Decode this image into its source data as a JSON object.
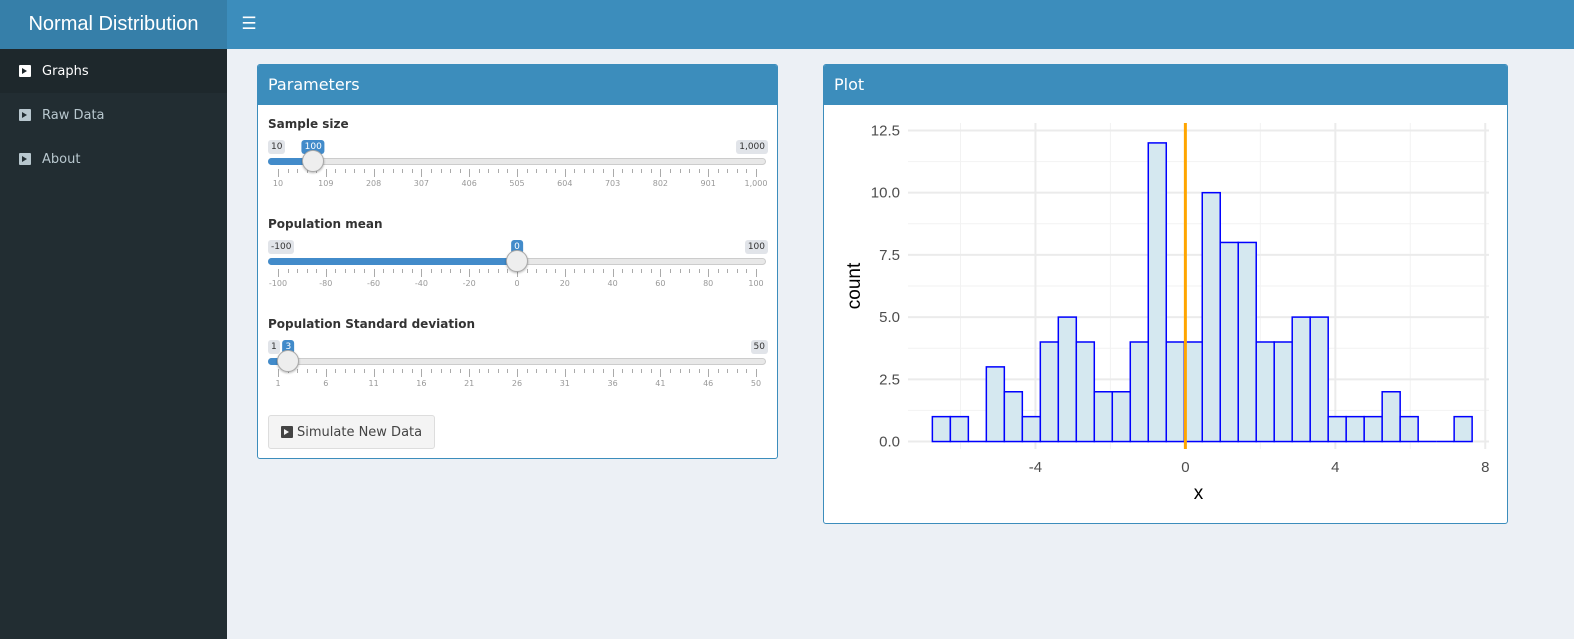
{
  "app": {
    "title": "Normal Distribution"
  },
  "sidebar": {
    "items": [
      {
        "label": "Graphs",
        "icon": "flag-icon",
        "active": true
      },
      {
        "label": "Raw Data",
        "icon": "flag-icon",
        "active": false
      },
      {
        "label": "About",
        "icon": "flag-icon",
        "active": false
      }
    ]
  },
  "parameters": {
    "title": "Parameters",
    "sliders": [
      {
        "label": "Sample size",
        "min_label": "10",
        "max_label": "1,000",
        "value_label": "100",
        "min": 10,
        "max": 1000,
        "value": 100,
        "ticks": [
          "10",
          "109",
          "208",
          "307",
          "406",
          "505",
          "604",
          "703",
          "802",
          "901",
          "1,000"
        ]
      },
      {
        "label": "Population mean",
        "min_label": "-100",
        "max_label": "100",
        "value_label": "0",
        "min": -100,
        "max": 100,
        "value": 0,
        "ticks": [
          "-100",
          "-80",
          "-60",
          "-40",
          "-20",
          "0",
          "20",
          "40",
          "60",
          "80",
          "100"
        ]
      },
      {
        "label": "Population Standard deviation",
        "min_label": "1",
        "max_label": "50",
        "value_label": "3",
        "min": 1,
        "max": 50,
        "value": 3,
        "ticks": [
          "1",
          "6",
          "11",
          "16",
          "21",
          "26",
          "31",
          "36",
          "41",
          "46",
          "50"
        ]
      }
    ],
    "button_label": "Simulate New Data",
    "button_icon": "flag-icon"
  },
  "plot": {
    "title": "Plot"
  },
  "chart_data": {
    "type": "bar",
    "xlabel": "x",
    "ylabel": "count",
    "xlim": [
      -7.4,
      8.1
    ],
    "ylim": [
      -0.3,
      12.8
    ],
    "x_ticks": [
      -4,
      0,
      4,
      8
    ],
    "x_tick_labels": [
      "-4",
      "0",
      "4",
      "8"
    ],
    "y_ticks": [
      0,
      2.5,
      5,
      7.5,
      10,
      12.5
    ],
    "y_tick_labels": [
      "0.0",
      "2.5",
      "5.0",
      "7.5",
      "10.0",
      "12.5"
    ],
    "bin_width": 0.48,
    "bin_start": -6.75,
    "counts": [
      1,
      1,
      0,
      3,
      2,
      1,
      4,
      5,
      4,
      2,
      2,
      4,
      12,
      4,
      4,
      10,
      8,
      8,
      4,
      4,
      5,
      5,
      1,
      1,
      1,
      2,
      1,
      0,
      0,
      1
    ],
    "vline": 0,
    "bar_fill": "#d5e8f0",
    "bar_stroke": "#0000ff",
    "vline_color": "#ffa500",
    "grid": true
  }
}
